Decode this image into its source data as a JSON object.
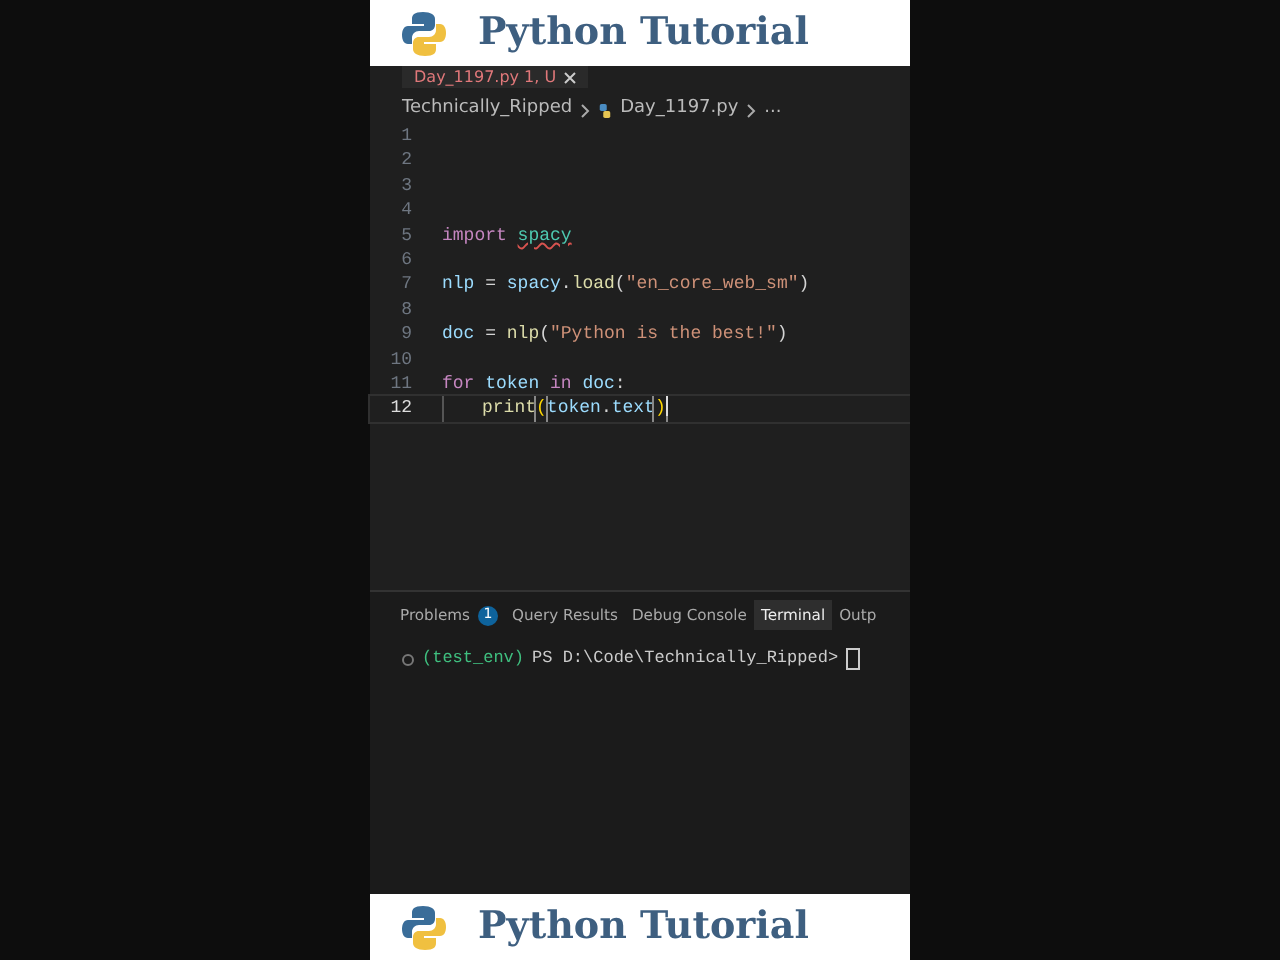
{
  "banner_top": {
    "title": "Python Tutorial"
  },
  "editor": {
    "tabs": [
      {
        "label": "Day_1197.py",
        "badge": "1, U",
        "selected": true
      }
    ],
    "breadcrumb": [
      "Technically_Ripped",
      "Day_1197.py",
      "..."
    ],
    "lines": [
      {
        "number": "1",
        "current": false
      },
      {
        "number": "2",
        "current": false
      },
      {
        "number": "3",
        "current": false
      },
      {
        "number": "4",
        "current": false
      },
      {
        "number": "5",
        "current": false,
        "tokens": [
          {
            "kind": "keyword",
            "text": "import"
          },
          {
            "kind": "warn",
            "text": "spacy"
          }
        ]
      },
      {
        "number": "6",
        "current": false
      },
      {
        "number": "7",
        "current": false,
        "tokens": [
          {
            "kind": "var",
            "text": "nlp"
          },
          {
            "kind": "plain",
            "text": "="
          },
          {
            "kind": "var",
            "text": "spacy"
          },
          {
            "kind": "plain",
            "text": "."
          },
          {
            "kind": "func",
            "text": "load"
          },
          {
            "kind": "bracket",
            "text": "("
          },
          {
            "kind": "string",
            "text": "\"en_core_web_sm\""
          },
          {
            "kind": "bracket",
            "text": ")"
          }
        ]
      },
      {
        "number": "8",
        "current": false
      },
      {
        "number": "9",
        "current": false,
        "tokens": [
          {
            "kind": "var",
            "text": "doc"
          },
          {
            "kind": "plain",
            "text": "="
          },
          {
            "kind": "func",
            "text": "nlp"
          },
          {
            "kind": "bracket",
            "text": "("
          },
          {
            "kind": "string",
            "text": "\"Python is the best!\""
          },
          {
            "kind": "bracket",
            "text": ")"
          }
        ]
      },
      {
        "number": "10",
        "current": false
      },
      {
        "number": "11",
        "current": false,
        "tokens": [
          {
            "kind": "keyword",
            "text": "for"
          },
          {
            "kind": "var",
            "text": "token"
          },
          {
            "kind": "keyword",
            "text": "in"
          },
          {
            "kind": "var",
            "text": "doc"
          },
          {
            "kind": "plain",
            "text": ":"
          }
        ]
      },
      {
        "number": "12",
        "current": true,
        "indented": true,
        "tokens": [
          {
            "kind": "func",
            "text": "print"
          },
          {
            "kind": "match",
            "text": "("
          },
          {
            "kind": "var",
            "text": "token"
          },
          {
            "kind": "plain",
            "text": "."
          },
          {
            "kind": "var",
            "text": "text"
          },
          {
            "kind": "match",
            "text": ")"
          }
        ]
      }
    ]
  },
  "panel": {
    "tabs": [
      {
        "label": "Problems",
        "badge": "1",
        "selected": false
      },
      {
        "label": "Query Results",
        "selected": false
      },
      {
        "label": "Debug Console",
        "selected": false
      },
      {
        "label": "Terminal",
        "selected": true
      },
      {
        "label": "Outp",
        "selected": false
      }
    ],
    "terminal": {
      "env": "(test_env)",
      "prompt": "PS D:\\Code\\Technically_Ripped>"
    }
  },
  "banner_bottom": {
    "title": "Python Tutorial"
  }
}
